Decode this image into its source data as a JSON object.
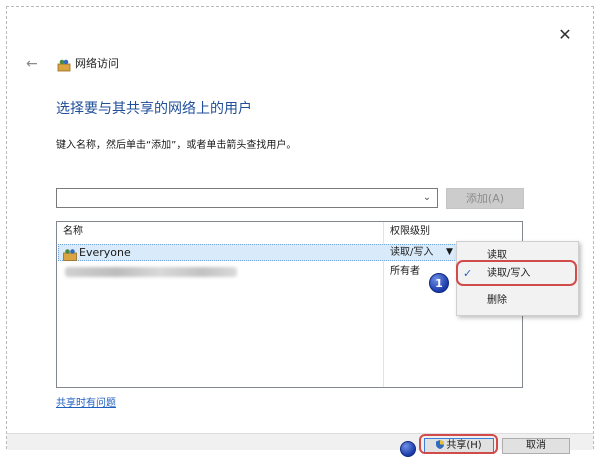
{
  "window": {
    "title": "网络访问",
    "close_glyph": "✕",
    "back_glyph": "←",
    "icons": {
      "title": "network-share-icon",
      "back": "back-arrow-icon",
      "close": "close-icon"
    }
  },
  "main": {
    "heading": "选择要与其共享的网络上的用户",
    "instruction": "键入名称，然后单击“添加”，或者单击箭头查找用户。",
    "combo": {
      "value": "",
      "arrow_glyph": "⌄"
    },
    "add_button": "添加(A)"
  },
  "table": {
    "columns": [
      "名称",
      "权限级别"
    ],
    "rows": [
      {
        "name": "Everyone",
        "permission": "读取/写入",
        "arrow": "▼",
        "selected": true
      },
      {
        "name": "",
        "permission": "所有者",
        "selected": false
      }
    ]
  },
  "context_menu": {
    "items": [
      "读取",
      "读取/写入",
      "删除"
    ],
    "checked_index": 1,
    "check_glyph": "✓"
  },
  "annotations": {
    "step_badge": "1"
  },
  "footer": {
    "help_link": "共享时有问题",
    "share_button": "共享(H)",
    "cancel_button": "取消"
  },
  "colors": {
    "heading": "#1f4e9a",
    "link": "#1f5fbf",
    "selection": "#d9ebfb",
    "highlight_ring": "#d24b4b",
    "badge": "#1a3aa8"
  }
}
